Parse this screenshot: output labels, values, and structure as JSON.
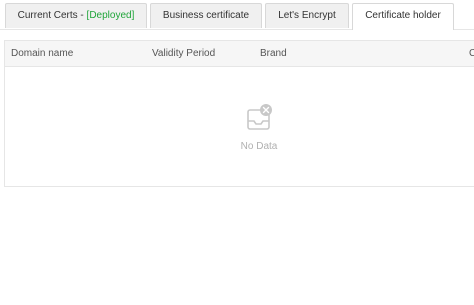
{
  "tabs": [
    {
      "label": "Current Certs - ",
      "status": "[Deployed]",
      "active": false
    },
    {
      "label": "Business certificate",
      "active": false
    },
    {
      "label": "Let's Encrypt",
      "active": false
    },
    {
      "label": "Certificate holder",
      "active": true
    }
  ],
  "table": {
    "columns": [
      "Domain name",
      "Validity Period",
      "Brand",
      "C"
    ],
    "empty_text": "No Data",
    "empty_icon": "empty-inbox-icon"
  },
  "colors": {
    "deployed": "#20a53a",
    "tab_bg": "#f0f0f0",
    "header_bg": "#f6f6f6",
    "border": "#e6e6e6"
  }
}
